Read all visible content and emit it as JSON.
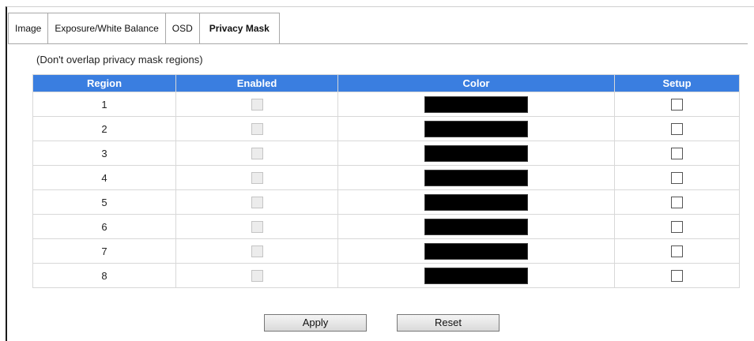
{
  "tabs": [
    {
      "label": "Image",
      "active": false
    },
    {
      "label": "Exposure/White Balance",
      "active": false
    },
    {
      "label": "OSD",
      "active": false
    },
    {
      "label": "Privacy Mask",
      "active": true
    }
  ],
  "note": "(Don't overlap privacy mask regions)",
  "table": {
    "headers": {
      "region": "Region",
      "enabled": "Enabled",
      "color": "Color",
      "setup": "Setup"
    },
    "rows": [
      {
        "region": "1",
        "enabled": false,
        "color": "#000000",
        "setup": false
      },
      {
        "region": "2",
        "enabled": false,
        "color": "#000000",
        "setup": false
      },
      {
        "region": "3",
        "enabled": false,
        "color": "#000000",
        "setup": false
      },
      {
        "region": "4",
        "enabled": false,
        "color": "#000000",
        "setup": false
      },
      {
        "region": "5",
        "enabled": false,
        "color": "#000000",
        "setup": false
      },
      {
        "region": "6",
        "enabled": false,
        "color": "#000000",
        "setup": false
      },
      {
        "region": "7",
        "enabled": false,
        "color": "#000000",
        "setup": false
      },
      {
        "region": "8",
        "enabled": false,
        "color": "#000000",
        "setup": false
      }
    ]
  },
  "buttons": {
    "apply": "Apply",
    "reset": "Reset"
  },
  "colors": {
    "header_bg": "#3a7ee0",
    "header_text": "#ffffff",
    "mask_color": "#000000"
  }
}
